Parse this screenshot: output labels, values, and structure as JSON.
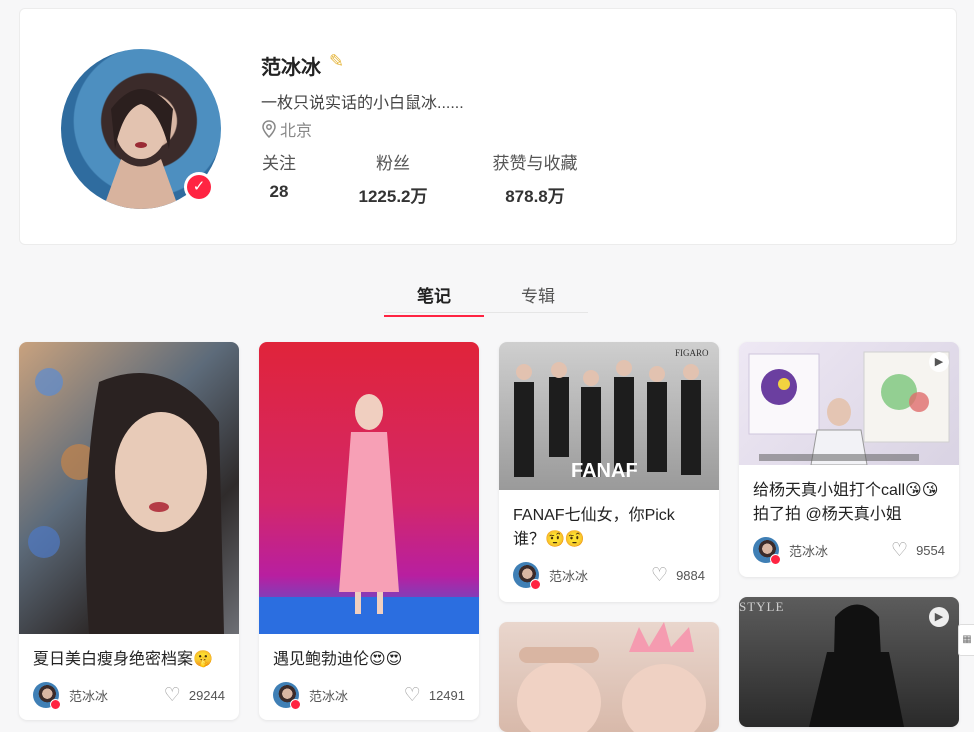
{
  "profile": {
    "name": "范冰冰",
    "bio": "一枚只说实话的小白鼠冰......",
    "location": "北京",
    "stats": [
      {
        "label": "关注",
        "value": "28"
      },
      {
        "label": "粉丝",
        "value": "1225.2万"
      },
      {
        "label": "获赞与收藏",
        "value": "878.8万"
      }
    ]
  },
  "tabs": [
    {
      "label": "笔记"
    },
    {
      "label": "专辑"
    }
  ],
  "icons": {
    "location": "map-pin-icon",
    "verified": "verified-badge-icon",
    "like": "heart-icon",
    "video": "play-icon"
  },
  "colors": {
    "accent": "#ff2442",
    "background": "#f7f7f8"
  },
  "notes": [
    {
      "title": "夏日美白瘦身绝密档案🤫",
      "author": "范冰冰",
      "likes": "29244",
      "video": false
    },
    {
      "title": "遇见鲍勃迪伦😍😍",
      "author": "范冰冰",
      "likes": "12491",
      "video": false
    },
    {
      "title": "FANAF七仙女，你Pick谁？🤨🤨",
      "author": "范冰冰",
      "likes": "9884",
      "video": false
    },
    {
      "title": "给杨天真小姐打个call😘😘拍了拍 @杨天真小姐",
      "author": "范冰冰",
      "likes": "9554",
      "video": true
    },
    {
      "title": "",
      "author": "",
      "likes": "",
      "video": false
    },
    {
      "title": "",
      "author": "",
      "likes": "",
      "video": true
    }
  ],
  "thumb_text": {
    "fanaf_brand": "FIGARO",
    "fanaf_logo": "FANAF",
    "style_mag": "STYLE"
  }
}
